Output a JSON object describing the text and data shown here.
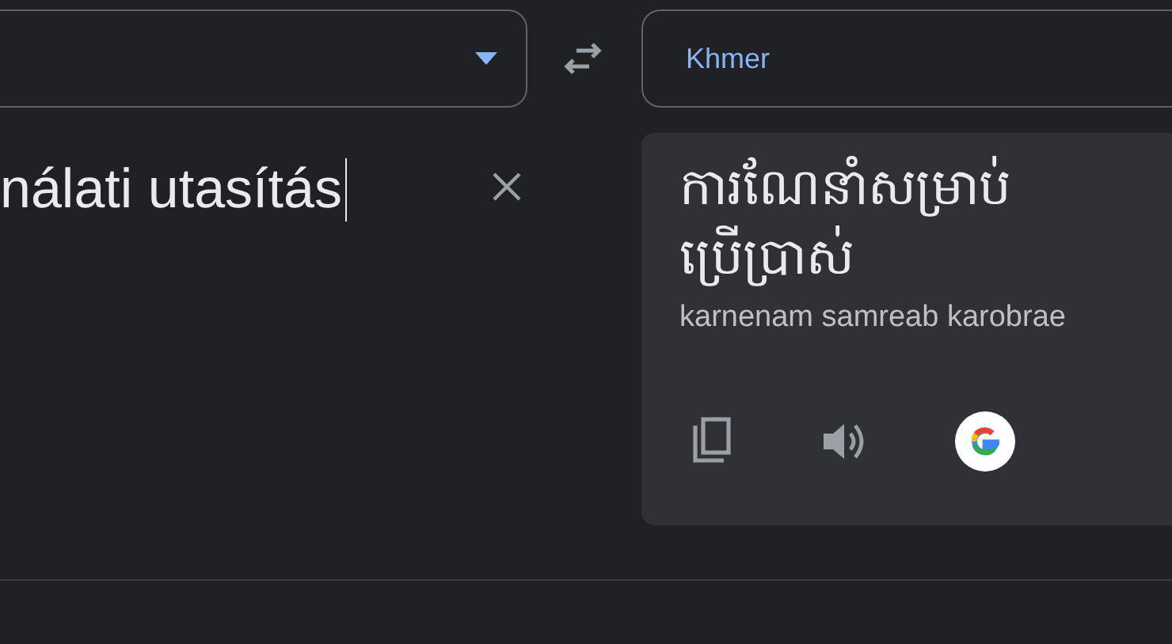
{
  "source_language": {
    "expanded": false
  },
  "target_language": {
    "label": "Khmer"
  },
  "source_text": {
    "value": "nálati utasítás"
  },
  "translation": {
    "text": "ការណែនាំសម្រាប់ ប្រើប្រាស់",
    "romanization": "karnenam samreab karobrae"
  }
}
